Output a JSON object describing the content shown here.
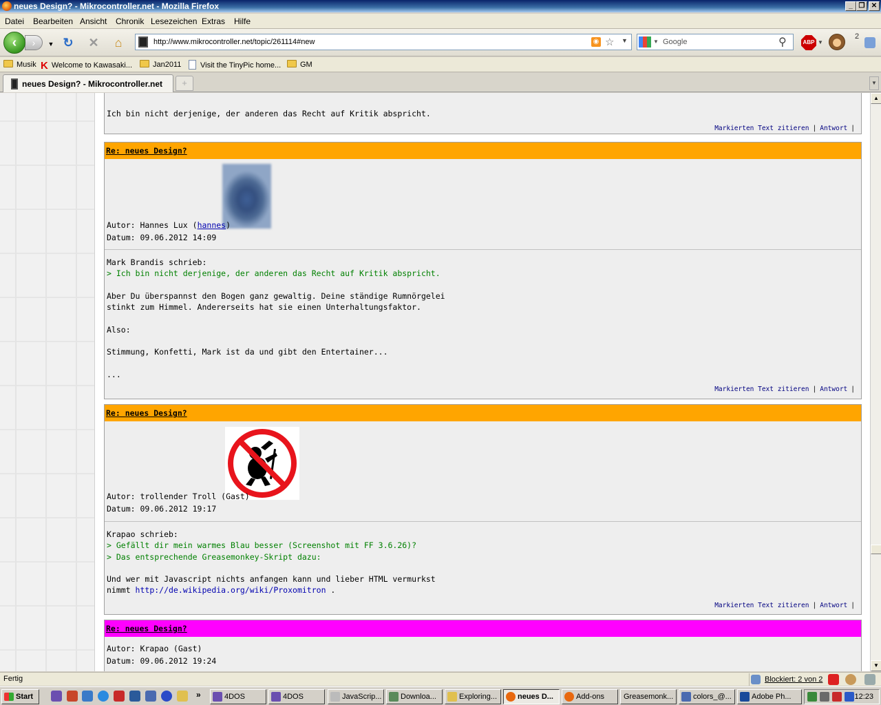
{
  "window": {
    "title": "neues Design? - Mikrocontroller.net - Mozilla Firefox",
    "minimize": "_",
    "restore": "❐",
    "close": "✕"
  },
  "menu": [
    "Datei",
    "Bearbeiten",
    "Ansicht",
    "Chronik",
    "Lesezeichen",
    "Extras",
    "Hilfe"
  ],
  "nav": {
    "url": "http://www.mikrocontroller.net/topic/261114#new",
    "search_placeholder": "Google",
    "abp_label": "ABP",
    "notification_count": "2"
  },
  "bookmarks": [
    "Musik",
    "Welcome to Kawasaki...",
    "Jan2011",
    "Visit the TinyPic home...",
    "GM"
  ],
  "tab": {
    "label": "neues Design? - Mikrocontroller.net"
  },
  "posts": {
    "prev": {
      "text": "Ich bin nicht derjenige, der anderen das Recht auf Kritik abspricht.",
      "quote_action": "Markierten Text zitieren",
      "reply_action": "Antwort"
    },
    "p1": {
      "subject": "Re: neues Design?",
      "author_label": "Autor: Hannes Lux (",
      "author_link": "hannes",
      "author_close": ")",
      "date": "Datum: 09.06.2012 14:09",
      "l1": "Mark Brandis schrieb:",
      "l2": "> Ich bin nicht derjenige, der anderen das Recht auf Kritik abspricht.",
      "l3": "Aber Du überspannst den Bogen ganz gewaltig. Deine ständige Rumnörgelei",
      "l4": "stinkt zum Himmel. Andererseits hat sie einen Unterhaltungsfaktor.",
      "l5": "Also:",
      "l6": "Stimmung, Konfetti, Mark ist da und gibt den Entertainer...",
      "l7": "...",
      "quote_action": "Markierten Text zitieren",
      "reply_action": "Antwort"
    },
    "p2": {
      "subject": "Re: neues Design?",
      "author": "Autor: trollender Troll (Gast)",
      "date": "Datum: 09.06.2012 19:17",
      "l1": "Krapao schrieb:",
      "l2": "> Gefällt dir mein warmes Blau besser (Screenshot mit FF 3.6.26)?",
      "l3": "> Das entsprechende Greasemonkey-Skript dazu:",
      "l4": "Und wer mit Javascript nichts anfangen kann und lieber HTML vermurkst",
      "l5a": "nimmt ",
      "l5link": "http://de.wikipedia.org/wiki/Proxomitron",
      "l5b": " .",
      "quote_action": "Markierten Text zitieren",
      "reply_action": "Antwort"
    },
    "p3": {
      "subject": "Re: neues Design?",
      "author": "Autor: Krapao (Gast)",
      "date": "Datum: 09.06.2012 19:24"
    },
    "separator": "|"
  },
  "status": {
    "text": "Fertig",
    "blocked": "Blockiert: 2 von 2"
  },
  "taskbar": {
    "start": "Start",
    "overflow": "»",
    "tasks": [
      "4DOS",
      "4DOS",
      "JavaScrip...",
      "Downloa...",
      "Exploring...",
      "neues D...",
      "Add-ons",
      "Greasemonk...",
      "colors_@...",
      "Adobe Ph..."
    ],
    "clock": "12:23"
  },
  "colors": {
    "post_header": "#ffa500",
    "new_post_header": "#ff00ff",
    "quote": "#008000",
    "link": "#0000b0"
  }
}
